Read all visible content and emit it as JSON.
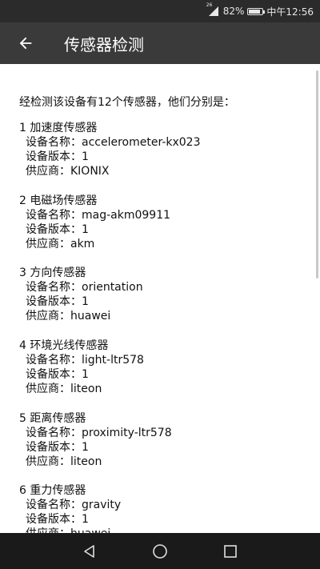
{
  "status": {
    "signal": "26",
    "battery": "82%",
    "time": "中午12:56",
    "battery_level": 0.82
  },
  "header": {
    "title": "传感器检测"
  },
  "intro": "经检测该设备有12个传感器，他们分别是：",
  "sensors": [
    {
      "heading": "1 加速度传感器",
      "name": "设备名称：accelerometer-kx023",
      "version": "设备版本：1",
      "vendor": "供应商：KIONIX"
    },
    {
      "heading": "2 电磁场传感器",
      "name": "设备名称：mag-akm09911",
      "version": "设备版本：1",
      "vendor": "供应商：akm"
    },
    {
      "heading": "3 方向传感器",
      "name": "设备名称：orientation",
      "version": "设备版本：1",
      "vendor": "供应商：huawei"
    },
    {
      "heading": "4 环境光线传感器",
      "name": "设备名称：light-ltr578",
      "version": "设备版本：1",
      "vendor": "供应商：liteon"
    },
    {
      "heading": "5 距离传感器",
      "name": "设备名称：proximity-ltr578",
      "version": "设备版本：1",
      "vendor": "供应商：liteon"
    },
    {
      "heading": "6 重力传感器",
      "name": "设备名称：gravity",
      "version": "设备版本：1",
      "vendor": "供应商：huawei"
    }
  ]
}
